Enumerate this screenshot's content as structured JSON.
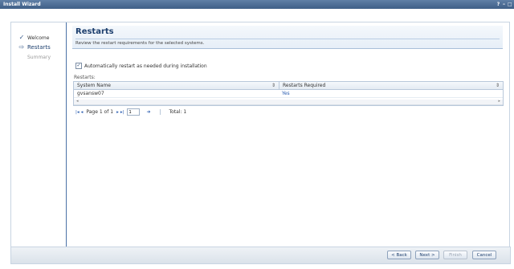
{
  "window": {
    "title": "Install Wizard",
    "controls": [
      "?",
      "–",
      "□"
    ]
  },
  "nav": {
    "steps": [
      {
        "icon": "checkmark-icon",
        "label": "Welcome",
        "state": "done"
      },
      {
        "icon": "arrow-right-icon",
        "label": "Restarts",
        "state": "current"
      },
      {
        "icon": "",
        "label": "Summary",
        "state": "pending"
      }
    ]
  },
  "page": {
    "title": "Restarts",
    "description": "Review the restart requirements for the selected systems."
  },
  "auto_restart": {
    "label": "Automatically restart as needed during installation",
    "checked": true
  },
  "table": {
    "caption": "Restarts:",
    "columns": [
      "System Name",
      "Restarts Required"
    ],
    "rows": [
      [
        "gvsansw07",
        "Yes"
      ]
    ]
  },
  "pager": {
    "page_label": "Page 1 of 1",
    "page_value": "1",
    "total_label": "Total: 1"
  },
  "buttons": {
    "back": "< Back",
    "next": "Next >",
    "finish": "Finish",
    "cancel": "Cancel"
  },
  "colors": {
    "title_bar": "#4a6b93",
    "accent": "#1d3f6e",
    "link": "#2a5db0"
  }
}
